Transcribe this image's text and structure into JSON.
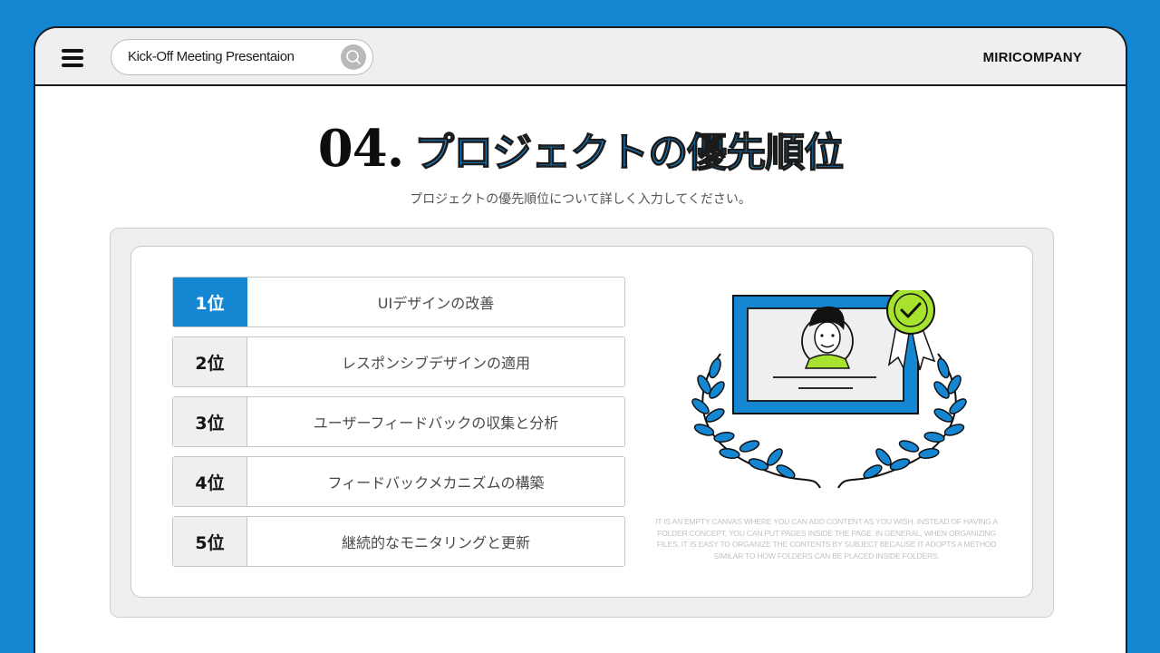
{
  "topbar": {
    "search_value": "Kick-Off Meeting Presentaion",
    "brand": "MIRICOMPANY"
  },
  "slide": {
    "number": "04.",
    "title": "プロジェクトの優先順位",
    "subtitle": "プロジェクトの優先順位について詳しく入力してください。"
  },
  "priorities": [
    {
      "rank": "1位",
      "label": "UIデザインの改善"
    },
    {
      "rank": "2位",
      "label": "レスポンシブデザインの適用"
    },
    {
      "rank": "3位",
      "label": "ユーザーフィードバックの収集と分析"
    },
    {
      "rank": "4位",
      "label": "フィードバックメカニズムの構築"
    },
    {
      "rank": "5位",
      "label": "継続的なモニタリングと更新"
    }
  ],
  "caption": "It is an empty canvas where you can add content as you wish. Instead of having a folder concept, you can put pages inside the page. In general, when organizing files, it is easy to organize the contents by subject because it adopts a method similar to how folders can be placed inside folders.",
  "colors": {
    "accent": "#1586d2",
    "highlight": "#a6e22e",
    "panel": "#efeff1"
  },
  "icons": [
    "hamburger-menu-icon",
    "search-icon",
    "checkmark-badge-icon",
    "certificate-illustration"
  ]
}
